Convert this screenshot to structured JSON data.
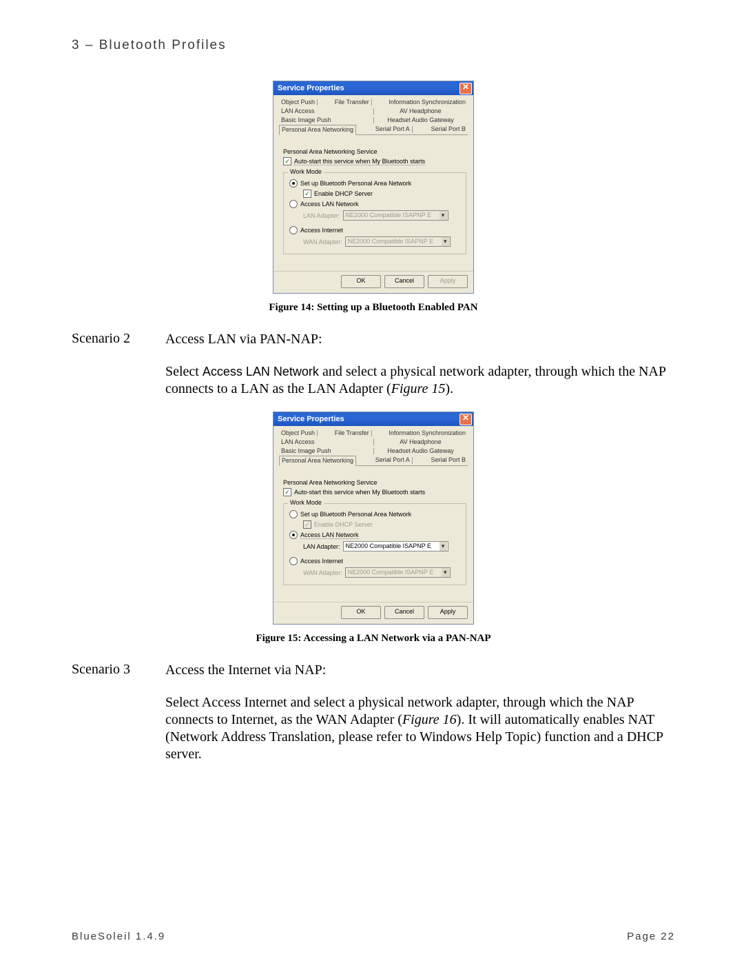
{
  "chapter": "3 – Bluetooth Profiles",
  "dialog": {
    "title": "Service Properties",
    "tabs": {
      "row1": [
        "Object Push",
        "File Transfer",
        "Information Synchronization"
      ],
      "row2": [
        "LAN Access",
        "AV Headphone"
      ],
      "row3": [
        "Basic Image Push",
        "Headset Audio Gateway"
      ],
      "row4": [
        "Personal Area Networking",
        "Serial Port A",
        "Serial Port B"
      ]
    },
    "section_label": "Personal Area Networking Service",
    "autostart_label": "Auto-start this service when My Bluetooth starts",
    "work_mode_legend": "Work Mode",
    "opt_pan": "Set up Bluetooth Personal Area Network",
    "opt_dhcp": "Enable DHCP Server",
    "opt_lan": "Access LAN Network",
    "lan_adapter_label": "LAN Adapter:",
    "opt_internet": "Access Internet",
    "wan_adapter_label": "WAN Adapter:",
    "adapter_value": "NE2000 Compatible ISAPNP E",
    "buttons": {
      "ok": "OK",
      "cancel": "Cancel",
      "apply": "Apply"
    }
  },
  "figure14_caption": "Figure 14: Setting up a Bluetooth Enabled PAN",
  "figure15_caption": "Figure 15: Accessing a LAN Network via a PAN-NAP",
  "scenario2": {
    "label": "Scenario 2",
    "title": "Access LAN via PAN-NAP:",
    "body_before": "Select ",
    "body_bold": "Access LAN Network",
    "body_after": " and select a physical network adapter, through which the NAP connects to a LAN as the LAN Adapter (",
    "body_em": "Figure 15",
    "body_close": ")."
  },
  "scenario3": {
    "label": "Scenario 3",
    "title": "Access the Internet via NAP:",
    "body_before": "Select Access Internet and select a physical network adapter, through which the NAP connects to Internet, as the WAN Adapter (",
    "body_em": "Figure 16",
    "body_after": "). It will automatically enables NAT (Network Address Translation, please refer to Windows Help Topic) function and a DHCP server."
  },
  "footer": {
    "product": "BlueSoleil 1.4.9",
    "page": "Page 22"
  }
}
